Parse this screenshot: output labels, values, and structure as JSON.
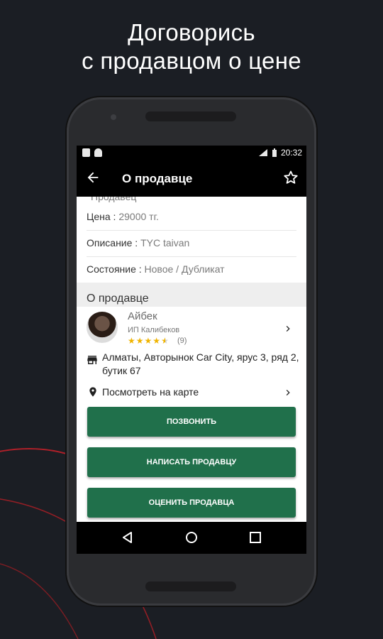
{
  "promo": {
    "line1": "Договорись",
    "line2": "с продавцом о цене"
  },
  "status_bar": {
    "time": "20:32"
  },
  "app_bar": {
    "title": "О продавце",
    "back_icon": "arrow-left-icon",
    "favorite_icon": "star-outline-icon"
  },
  "listing": {
    "cut_off_text": "Продавец",
    "rows": [
      {
        "label": "Цена : ",
        "value": "29000 тг."
      },
      {
        "label": "Описание : ",
        "value": "TYC taivan"
      },
      {
        "label": "Состояние : ",
        "value": "Новое / Дубликат"
      }
    ]
  },
  "seller_section": {
    "heading": "О продавце",
    "name": "Айбек",
    "company": "ИП Калибеков",
    "rating_stars": "★★★★★",
    "rating_value": 4.5,
    "review_count": "(9)",
    "address": "Алматы, Авторынок Car City, ярус 3, ряд 2, бутик 67",
    "map_link": "Посмотреть на карте"
  },
  "buttons": {
    "call": "ПОЗВОНИТЬ",
    "message": "НАПИСАТЬ ПРОДАВЦУ",
    "rate": "ОЦЕНИТЬ ПРОДАВЦА"
  },
  "colors": {
    "background": "#1b1e24",
    "button_green": "#20704b",
    "star_yellow": "#f0b400",
    "arc_red": "#c0202a"
  }
}
